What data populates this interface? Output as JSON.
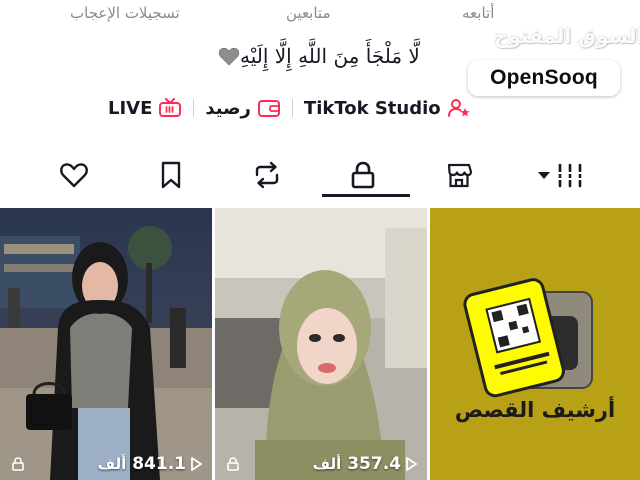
{
  "profile_stats": {
    "likes_label": "تسجيلات الإعجاب",
    "followers_label": "متابعين",
    "following_label": "أتابعه"
  },
  "watermark": {
    "arabic": "السوق المفتوح",
    "brand": "OpenSooq"
  },
  "bio": {
    "text": "لَّا مَلْجَأَ مِنَ اللَّهِ إِلَّا إِلَيْهِ",
    "emoji": "grey-heart-icon"
  },
  "links": {
    "live_label": "LIVE",
    "wallet_label": "رصيد",
    "studio_label": "TikTok Studio"
  },
  "tabs": [
    {
      "name": "liked",
      "icon": "heart-icon"
    },
    {
      "name": "favorites",
      "icon": "bookmark-icon"
    },
    {
      "name": "reposts",
      "icon": "repost-icon"
    },
    {
      "name": "private",
      "icon": "lock-icon",
      "selected": true
    },
    {
      "name": "shop",
      "icon": "shop-icon"
    },
    {
      "name": "videos",
      "icon": "grid-menu-icon"
    }
  ],
  "videos": [
    {
      "views": "841.1",
      "unit": "ألف",
      "locked": true
    },
    {
      "views": "357.4",
      "unit": "ألف",
      "locked": true
    }
  ],
  "archive": {
    "label": "أرشيف القصص"
  },
  "colors": {
    "accent_pink": "#fe2c55",
    "text_primary": "#161823",
    "text_secondary": "#8a8b91",
    "archive_bg": "#b8a017"
  }
}
